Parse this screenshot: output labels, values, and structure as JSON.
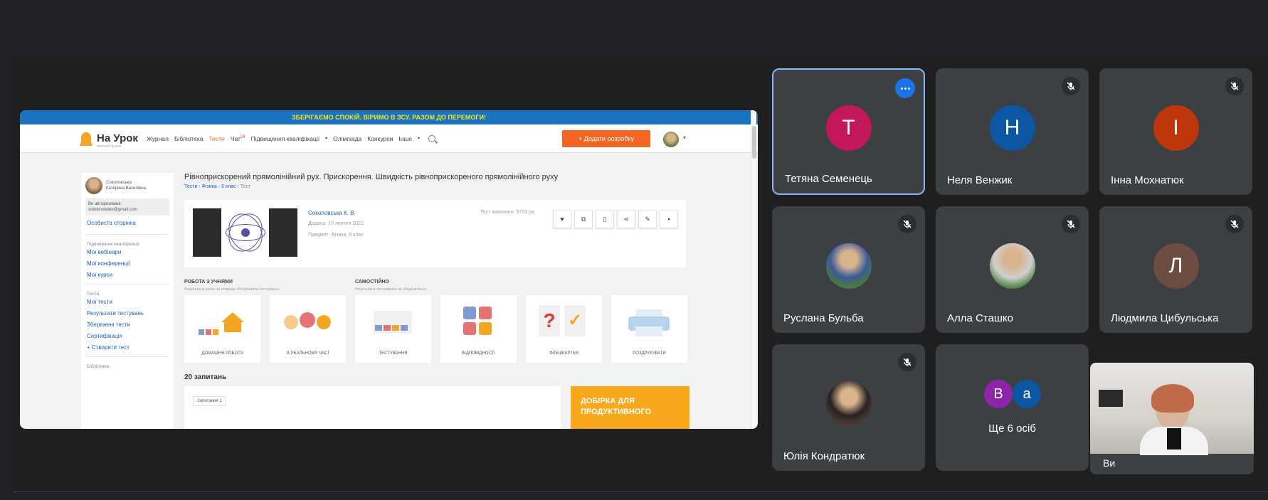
{
  "presentation": {
    "banner": "ЗБЕРІГАЄМО СПОКІЙ. ВІРИМО В ЗСУ. РАЗОМ ДО ПЕРЕМОГИ!",
    "logo": "На Урок",
    "logo_sub": "освітній проект",
    "nav": [
      "Журнал",
      "Бібліотека",
      "Тести",
      "Чат",
      "Підвищення кваліфікації",
      "Олімпіада",
      "Конкурси",
      "Інше"
    ],
    "nav_chat_badge": "24",
    "add_button": "+ Додати розробку",
    "sidebar": {
      "user_name_1": "Соколовська",
      "user_name_2": "Катерина Василівна",
      "auth_line1": "Ви авторизовані:",
      "auth_email": "sokolovskakv@gmail.com",
      "personal": "Особиста сторінка",
      "sec1": "Підвищення кваліфікації",
      "links1": [
        "Мої вебінари",
        "Мої конференції",
        "Мої курси"
      ],
      "sec2": "Тести",
      "links2": [
        "Мої тести",
        "Результати тестувань",
        "Збережені тести",
        "Сертифікація",
        "+ Створити тест"
      ],
      "sec3": "Бібліотека"
    },
    "title": "Рівноприскорений прямолінійний рух. Прискорення. Швидкість рівноприскореного прямолінійного руху",
    "crumbs": [
      "Тести",
      "Фізика",
      "9 клас",
      "Тест"
    ],
    "card": {
      "author": "Соколовська К. В.",
      "added": "Додано: 10 лютого 2022",
      "subject": "Предмет: Фізика, 9 клас",
      "done": "Тест виконано: 5703 ра"
    },
    "section_pupils": "РОБОТА З УЧНЯМИ",
    "section_pupils_sub": "Результати учнів на сторінці «Результати тестувань»",
    "section_self": "САМОСТІЙНО",
    "section_self_sub": "Результати тестування не зберігаються",
    "tiles": [
      "ДОМАШНЯ РОБОТА",
      "В РЕАЛЬНОМУ ЧАСІ",
      "ТЕСТУВАННЯ",
      "ВІДПОВІДНОСТІ",
      "ФЛЕШКАРТКИ",
      "РОЗДРУКУВАТИ"
    ],
    "questions_count": "20 запитань",
    "question_tag": "Запитання 1",
    "promo": "ДОБІРКА ДЛЯ ПРОДУКТИВНОГО"
  },
  "participants": [
    {
      "name": "Тетяна Семенець",
      "initial": "Т",
      "color": "#c2185b"
    },
    {
      "name": "Неля Венжик",
      "initial": "Н",
      "color": "#0b57a4"
    },
    {
      "name": "Інна Мохнатюк",
      "initial": "І",
      "color": "#bf360c"
    },
    {
      "name": "Руслана Бульба",
      "initial": "",
      "color": "#3f6b3a"
    },
    {
      "name": "Алла Сташко",
      "initial": "",
      "color": "#5a8a4a"
    },
    {
      "name": "Людмила Цибульська",
      "initial": "Л",
      "color": "#6d4c41"
    },
    {
      "name": "Юлія Кондратюк",
      "initial": "",
      "color": "#4a3b3b"
    }
  ],
  "more": {
    "label": "Ще 6 осіб",
    "initials": [
      "В",
      "a"
    ],
    "colors": [
      "#8e24aa",
      "#0b57a4"
    ]
  },
  "self": {
    "name": "Ви"
  }
}
